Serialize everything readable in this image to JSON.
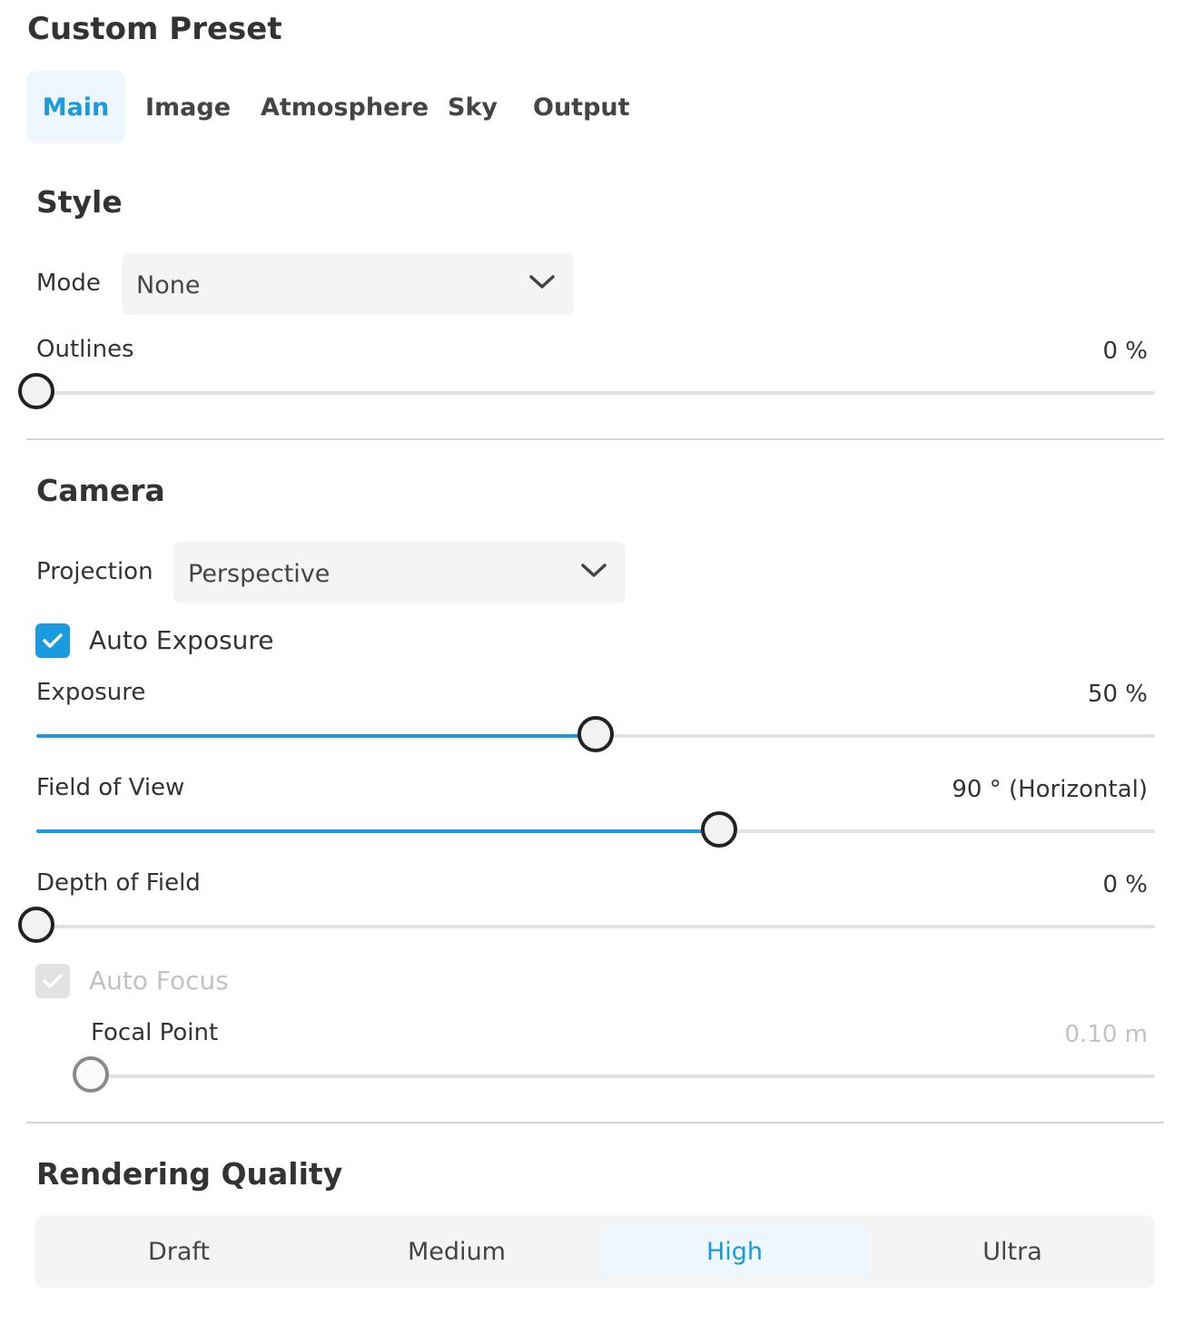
{
  "panel_title": "Custom Preset",
  "tabs": [
    {
      "label": "Main",
      "active": true
    },
    {
      "label": "Image",
      "active": false
    },
    {
      "label": "Atmosphere",
      "active": false
    },
    {
      "label": "Sky",
      "active": false
    },
    {
      "label": "Output",
      "active": false
    }
  ],
  "style": {
    "title": "Style",
    "mode": {
      "label": "Mode",
      "value": "None",
      "icon": "chevron-down-icon"
    },
    "outlines": {
      "label": "Outlines",
      "value_text": "0 %",
      "value": 0
    }
  },
  "camera": {
    "title": "Camera",
    "projection": {
      "label": "Projection",
      "value": "Perspective",
      "icon": "chevron-down-icon"
    },
    "auto_exposure": {
      "label": "Auto Exposure",
      "checked": true
    },
    "exposure": {
      "label": "Exposure",
      "value_text": "50 %",
      "value": 0.5
    },
    "field_of_view": {
      "label": "Field of View",
      "value_text": "90 ° (Horizontal)",
      "value": 0.61
    },
    "depth_of_field": {
      "label": "Depth of Field",
      "value_text": "0 %",
      "value": 0
    },
    "auto_focus": {
      "label": "Auto Focus",
      "checked": true,
      "disabled": true
    },
    "focal_point": {
      "label": "Focal Point",
      "value_text": "0.10 m",
      "value": 0,
      "disabled": true
    }
  },
  "rendering_quality": {
    "title": "Rendering Quality",
    "options": [
      "Draft",
      "Medium",
      "High",
      "Ultra"
    ],
    "selected": "High"
  },
  "colors": {
    "accent": "#1a9be0",
    "accent_bg": "#edf7fd",
    "text": "#333333",
    "disabled_text": "#c2c2c2"
  }
}
